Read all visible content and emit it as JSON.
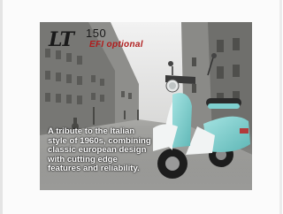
{
  "banner": {
    "logo_main": "LT",
    "logo_number": "150",
    "logo_subtitle": "EFI optional",
    "tagline": "A tribute to the Italian style of 1960s, combining classic european design with cutting edge features and reliability."
  },
  "colors": {
    "scooter_body": "#7fd0cf",
    "scooter_white": "#f2f4f4",
    "subtitle_red": "#b01d1d",
    "sepia_dark": "#4a4a48",
    "sepia_light": "#d9d9d7"
  }
}
